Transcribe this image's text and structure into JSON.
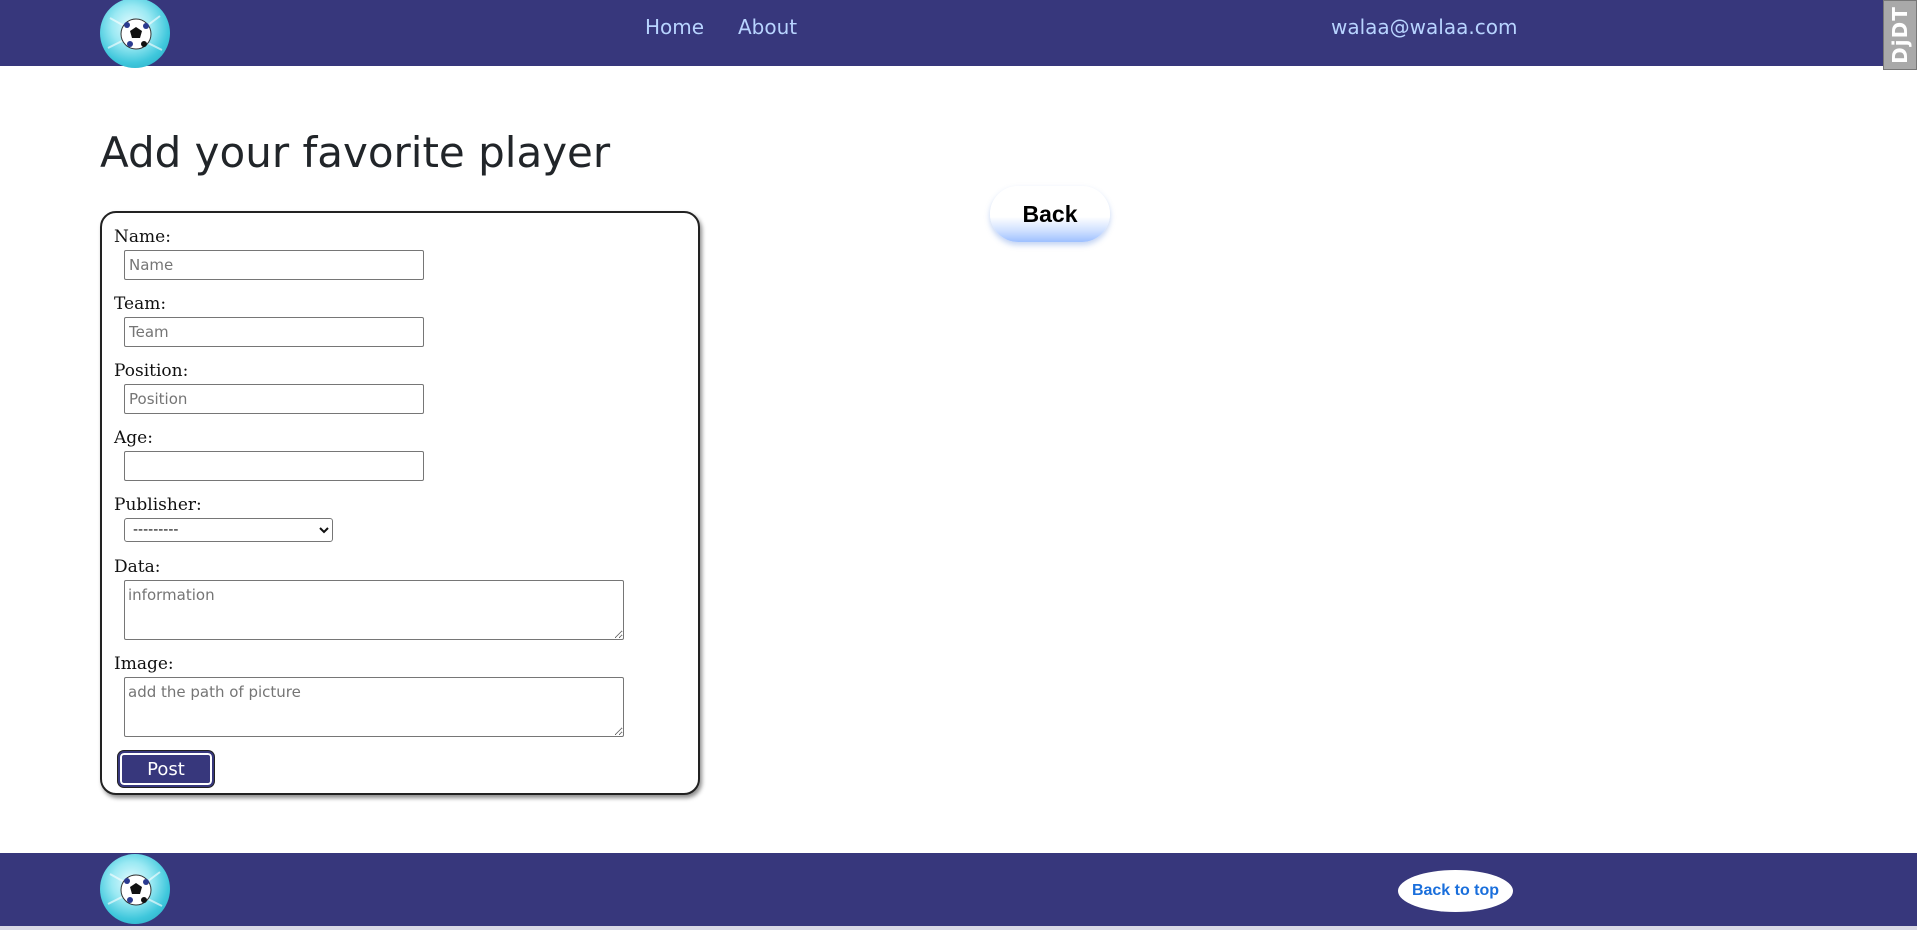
{
  "nav": {
    "links": [
      {
        "label": "Home"
      },
      {
        "label": "About"
      }
    ],
    "user_email": "walaa@walaa.com",
    "logo_icon": "soccer-ball-icon",
    "debug_toolbar_label": "DjDT"
  },
  "page": {
    "title": "Add your favorite player",
    "back_label": "Back"
  },
  "form": {
    "name": {
      "label": "Name:",
      "placeholder": "Name"
    },
    "team": {
      "label": "Team:",
      "placeholder": "Team"
    },
    "position": {
      "label": "Position:",
      "placeholder": "Position"
    },
    "age": {
      "label": "Age:",
      "value": ""
    },
    "publisher": {
      "label": "Publisher:",
      "selected": "---------"
    },
    "data": {
      "label": "Data:",
      "placeholder": "information"
    },
    "image": {
      "label": "Image:",
      "placeholder": "add the path of picture"
    },
    "submit_label": "Post"
  },
  "footer": {
    "back_to_top_label": "Back to top",
    "logo_icon": "soccer-ball-icon"
  },
  "colors": {
    "brand_navy": "#37377c",
    "nav_link": "#b8d4ff",
    "back_to_top_text": "#1a6fdc"
  }
}
